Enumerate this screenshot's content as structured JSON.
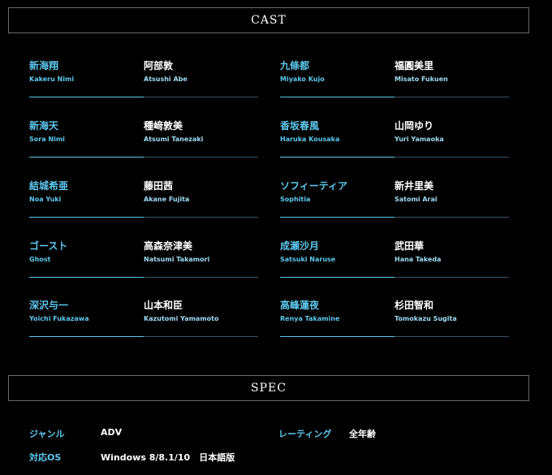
{
  "cast": {
    "title": "CAST",
    "rows": [
      [
        {
          "character": "新海翔",
          "character_roman": "Kakeru Nimi",
          "actor": "阿部敦",
          "actor_roman": "Atsushi Abe"
        },
        {
          "character": "九條都",
          "character_roman": "Miyako Kujo",
          "actor": "福圓美里",
          "actor_roman": "Misato Fukuen"
        }
      ],
      [
        {
          "character": "新海天",
          "character_roman": "Sora Nimi",
          "actor": "種﨑敦美",
          "actor_roman": "Atsumi Tanezaki"
        },
        {
          "character": "香坂春風",
          "character_roman": "Haruka Kousaka",
          "actor": "山岡ゆり",
          "actor_roman": "Yuri Yamaoka"
        }
      ],
      [
        {
          "character": "結城希亜",
          "character_roman": "Noa Yuki",
          "actor": "藤田茜",
          "actor_roman": "Akane Fujita"
        },
        {
          "character": "ソフィーティア",
          "character_roman": "Sophitia",
          "actor": "新井里美",
          "actor_roman": "Satomi Arai"
        }
      ],
      [
        {
          "character": "ゴースト",
          "character_roman": "Ghost",
          "actor": "高森奈津美",
          "actor_roman": "Natsumi Takamori"
        },
        {
          "character": "成瀬沙月",
          "character_roman": "Satsuki Naruse",
          "actor": "武田華",
          "actor_roman": "Hana Takeda"
        }
      ],
      [
        {
          "character": "深沢与一",
          "character_roman": "Yoichi Fukazawa",
          "actor": "山本和臣",
          "actor_roman": "Kazutomi Yamamoto"
        },
        {
          "character": "高峰蓮夜",
          "character_roman": "Renya Takamine",
          "actor": "杉田智和",
          "actor_roman": "Tomokazu Sugita"
        }
      ]
    ]
  },
  "spec": {
    "title": "SPEC",
    "genre_label": "ジャンル",
    "genre_value": "ADV",
    "rating_label": "レーティング",
    "rating_value": "全年齢",
    "os_label": "対応OS",
    "os_value": "Windows 8/8.1/10　日本語版"
  },
  "colors": {
    "background": "#000000",
    "accent": "#5ec8ee",
    "text": "#ffffff"
  }
}
